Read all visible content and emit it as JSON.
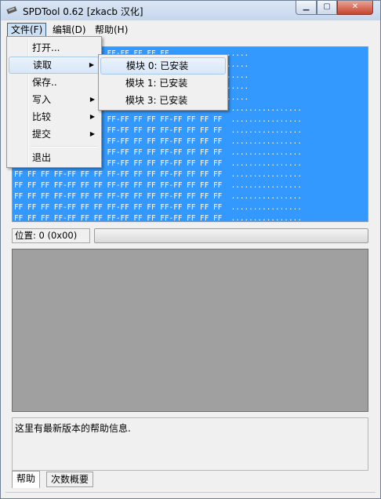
{
  "window": {
    "title": "SPDTool 0.62  [zkacb 汉化]",
    "min_glyph": "▁",
    "max_glyph": "▢",
    "close_glyph": "✕"
  },
  "menubar": {
    "items": [
      "文件(F)",
      "编辑(D)",
      "帮助(H)"
    ]
  },
  "file_menu": {
    "items": [
      {
        "label": "打开...",
        "submenu": false
      },
      {
        "label": "读取",
        "submenu": true
      },
      {
        "label": "保存..",
        "submenu": false
      },
      {
        "label": "写入",
        "submenu": true
      },
      {
        "label": "比较",
        "submenu": true
      },
      {
        "label": "提交",
        "submenu": true
      },
      {
        "label": "退出",
        "submenu": false
      }
    ],
    "arrow_glyph": "▶"
  },
  "read_submenu": {
    "items": [
      "模块 0: 已安装",
      "模块 1: 已安装",
      "模块 3: 已安装"
    ]
  },
  "hex": {
    "row_full": "FF FF FF FF-FF FF FF FF-FF FF FF FF  ................",
    "rows_tail": [
      "         FF FF FF FF-FF FF FF FF  ................",
      "               FF FF FF  ................",
      "               FF FF FF  ................",
      "               FF FF FF  ................",
      "               FF FF FF  ................",
      "FF FF FF FF-FF FF FF FF-FF FF FF FF-FF FF FF FF  ................",
      "FF FF FF FF-FF FF FF FF-FF FF FF FF-FF FF FF FF  ................",
      "FF FF FF FF-FF FF FF FF-FF FF FF FF-FF FF FF FF  ................",
      "FF FF FF FF-FF FF FF FF-FF FF FF FF-FF FF FF FF  ................",
      "FF FF FF FF-FF FF FF FF-FF FF FF FF-FF FF FF FF  ................",
      "FF FF FF FF-FF FF FF FF-FF FF FF FF-FF FF FF FF  ................",
      "FF FF FF FF-FF FF FF FF-FF FF FF FF-FF FF FF FF  ................",
      "FF FF FF FF-FF FF FF FF-FF FF FF FF-FF FF FF FF  ................",
      "FF FF FF FF-FF FF FF FF-FF FF FF FF-FF FF FF FF  ................",
      "FF FF FF FF-FF FF FF FF-FF FF FF FF-FF FF FF FF  ................"
    ]
  },
  "position": {
    "label": "位置: 0 (0x00)"
  },
  "progress": {
    "value": 0
  },
  "help": {
    "text": "这里有最新版本的帮助信息."
  },
  "tabs": [
    "帮助",
    "次数概要"
  ],
  "colors": {
    "selection": "#3399ff",
    "gray_area": "#a0a0a0"
  }
}
